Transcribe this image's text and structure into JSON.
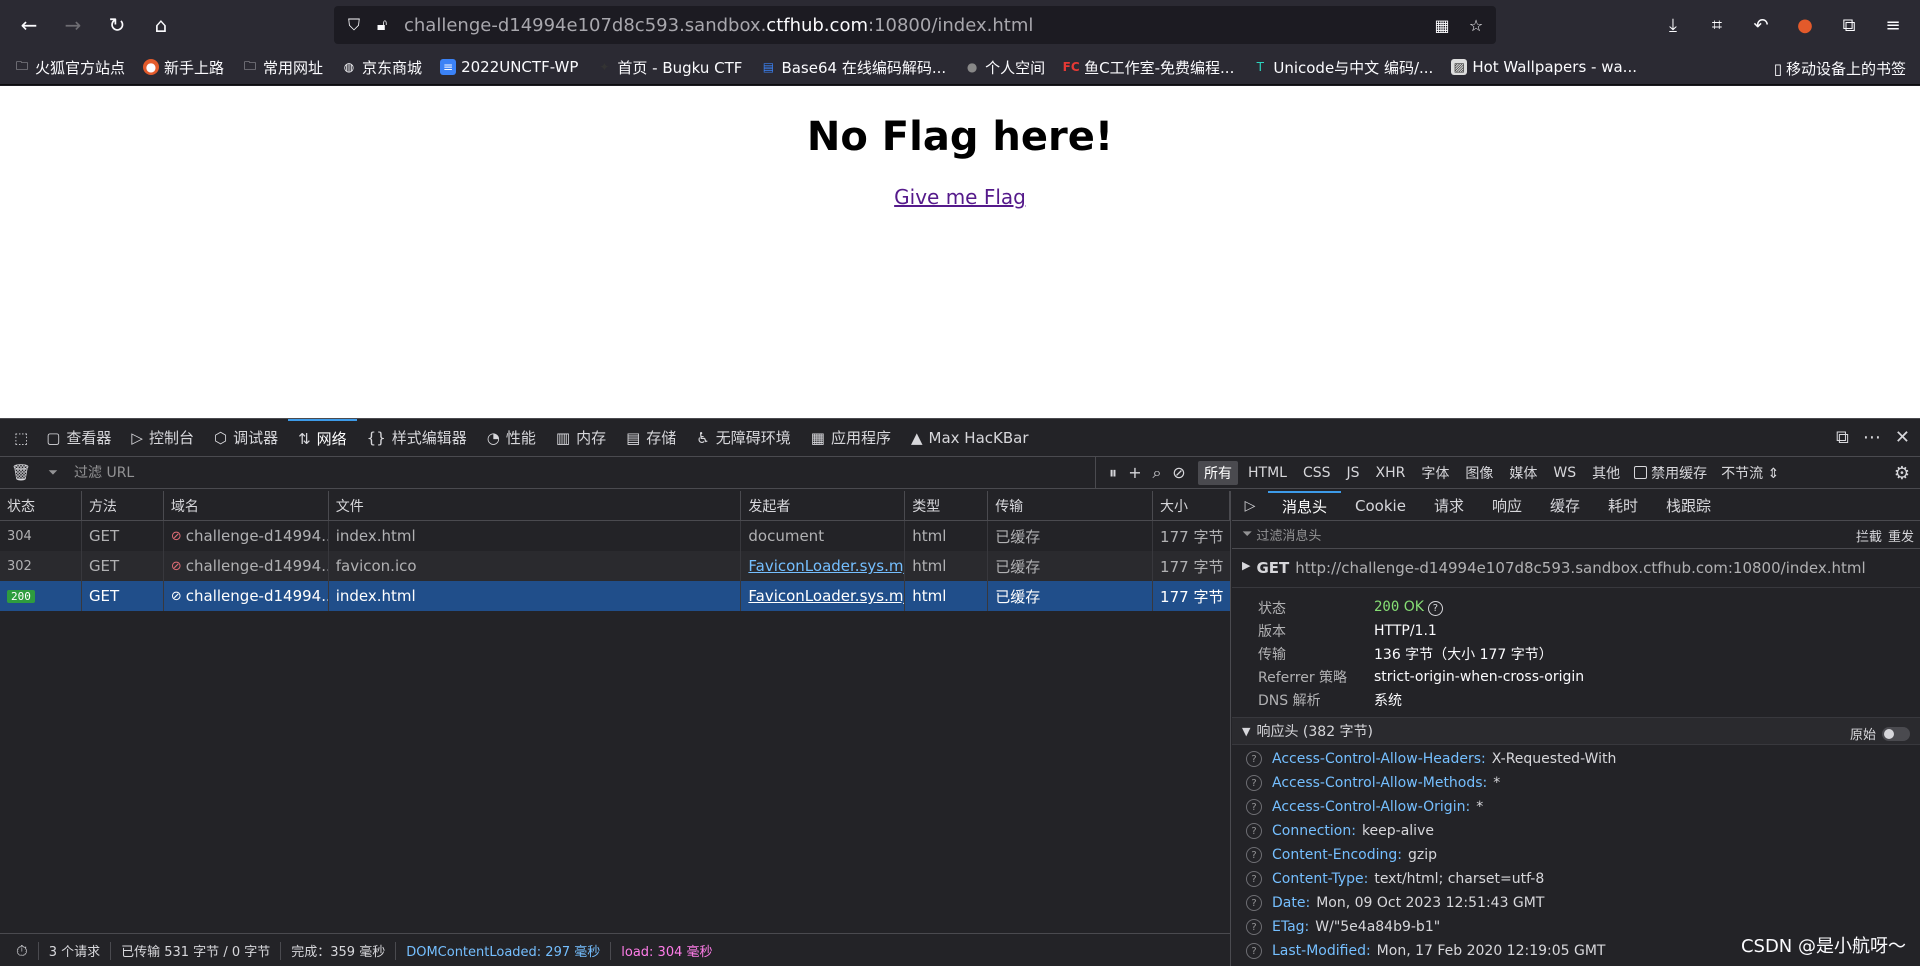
{
  "url": {
    "prefix": "challenge-d14994e107d8c593.sandbox.",
    "domain": "ctfhub.com",
    "suffix": ":10800/index.html"
  },
  "bookmarks": [
    {
      "label": "火狐官方站点",
      "icon": "folder-icon"
    },
    {
      "label": "新手上路",
      "icon": "firefox-icon"
    },
    {
      "label": "常用网址",
      "icon": "folder-icon"
    },
    {
      "label": "京东商城",
      "icon": "globe-icon"
    },
    {
      "label": "2022UNCTF-WP",
      "icon": "doc-icon"
    },
    {
      "label": "首页 - Bugku CTF",
      "icon": "bugku-icon"
    },
    {
      "label": "Base64 在线编码解码...",
      "icon": "base64-icon"
    },
    {
      "label": "个人空间",
      "icon": "user-icon"
    },
    {
      "label": "鱼C工作室-免费编程...",
      "icon": "fc-icon"
    },
    {
      "label": "Unicode与中文 编码/...",
      "icon": "unicode-icon"
    },
    {
      "label": "Hot Wallpapers - wa...",
      "icon": "wallpaper-icon"
    }
  ],
  "bookmark_mobile": "移动设备上的书签",
  "page": {
    "heading": "No Flag here!",
    "link": "Give me Flag"
  },
  "devtools": {
    "tabs": [
      {
        "label": "查看器",
        "icon": "inspector-icon"
      },
      {
        "label": "控制台",
        "icon": "console-icon"
      },
      {
        "label": "调试器",
        "icon": "debugger-icon"
      },
      {
        "label": "网络",
        "icon": "network-icon",
        "active": true
      },
      {
        "label": "样式编辑器",
        "icon": "style-editor-icon"
      },
      {
        "label": "性能",
        "icon": "performance-icon"
      },
      {
        "label": "内存",
        "icon": "memory-icon"
      },
      {
        "label": "存储",
        "icon": "storage-icon"
      },
      {
        "label": "无障碍环境",
        "icon": "accessibility-icon"
      },
      {
        "label": "应用程序",
        "icon": "application-icon"
      },
      {
        "label": "Max HacKBar",
        "icon": "hackbar-icon"
      }
    ],
    "filter_placeholder": "过滤 URL",
    "type_filters": [
      "所有",
      "HTML",
      "CSS",
      "JS",
      "XHR",
      "字体",
      "图像",
      "媒体",
      "WS",
      "其他"
    ],
    "disable_cache": "禁用缓存",
    "throttle": "不节流 ⇕",
    "columns": [
      "状态",
      "方法",
      "域名",
      "文件",
      "发起者",
      "类型",
      "传输",
      "大小"
    ],
    "requests": [
      {
        "status": "304",
        "method": "GET",
        "domain": "challenge-d14994...",
        "file": "index.html",
        "initiator": "document",
        "type": "html",
        "transfer": "已缓存",
        "size": "177 字节"
      },
      {
        "status": "302",
        "method": "GET",
        "domain": "challenge-d14994...",
        "file": "favicon.ico",
        "initiator": "FaviconLoader.sys.mj...",
        "type": "html",
        "transfer": "已缓存",
        "size": "177 字节"
      },
      {
        "status": "200",
        "method": "GET",
        "domain": "challenge-d14994...",
        "file": "index.html",
        "initiator": "FaviconLoader.sys.mj...",
        "type": "html",
        "transfer": "已缓存",
        "size": "177 字节"
      }
    ],
    "side_tabs": [
      "消息头",
      "Cookie",
      "请求",
      "响应",
      "缓存",
      "耗时",
      "栈跟踪"
    ],
    "header_filter_placeholder": "过滤消息头",
    "header_actions": [
      "拦截",
      "重发"
    ],
    "request_method": "GET",
    "request_url": "http://challenge-d14994e107d8c593.sandbox.ctfhub.com:10800/index.html",
    "summary": {
      "status_label": "状态",
      "status_code": "200",
      "status_text": "OK",
      "version_label": "版本",
      "version": "HTTP/1.1",
      "transfer_label": "传输",
      "transfer": "136 字节（大小 177 字节）",
      "referrer_label": "Referrer 策略",
      "referrer": "strict-origin-when-cross-origin",
      "dns_label": "DNS 解析",
      "dns": "系统"
    },
    "response_heading": "响应头 (382 字节)",
    "raw_label": "原始",
    "response_headers": [
      {
        "name": "Access-Control-Allow-Headers:",
        "value": "X-Requested-With"
      },
      {
        "name": "Access-Control-Allow-Methods:",
        "value": "*"
      },
      {
        "name": "Access-Control-Allow-Origin:",
        "value": "*"
      },
      {
        "name": "Connection:",
        "value": "keep-alive"
      },
      {
        "name": "Content-Encoding:",
        "value": "gzip"
      },
      {
        "name": "Content-Type:",
        "value": "text/html; charset=utf-8"
      },
      {
        "name": "Date:",
        "value": "Mon, 09 Oct 2023 12:51:43 GMT"
      },
      {
        "name": "ETag:",
        "value": "W/\"5e4a84b9-b1\""
      },
      {
        "name": "Last-Modified:",
        "value": "Mon, 17 Feb 2020 12:19:05 GMT"
      }
    ],
    "status_bar": {
      "requests": "3 个请求",
      "transferred": "已传输 531 字节 / 0 字节",
      "finish": "完成：359 毫秒",
      "dcl": "DOMContentLoaded: 297 毫秒",
      "load": "load: 304 毫秒"
    }
  },
  "watermark": "CSDN @是小航呀～"
}
